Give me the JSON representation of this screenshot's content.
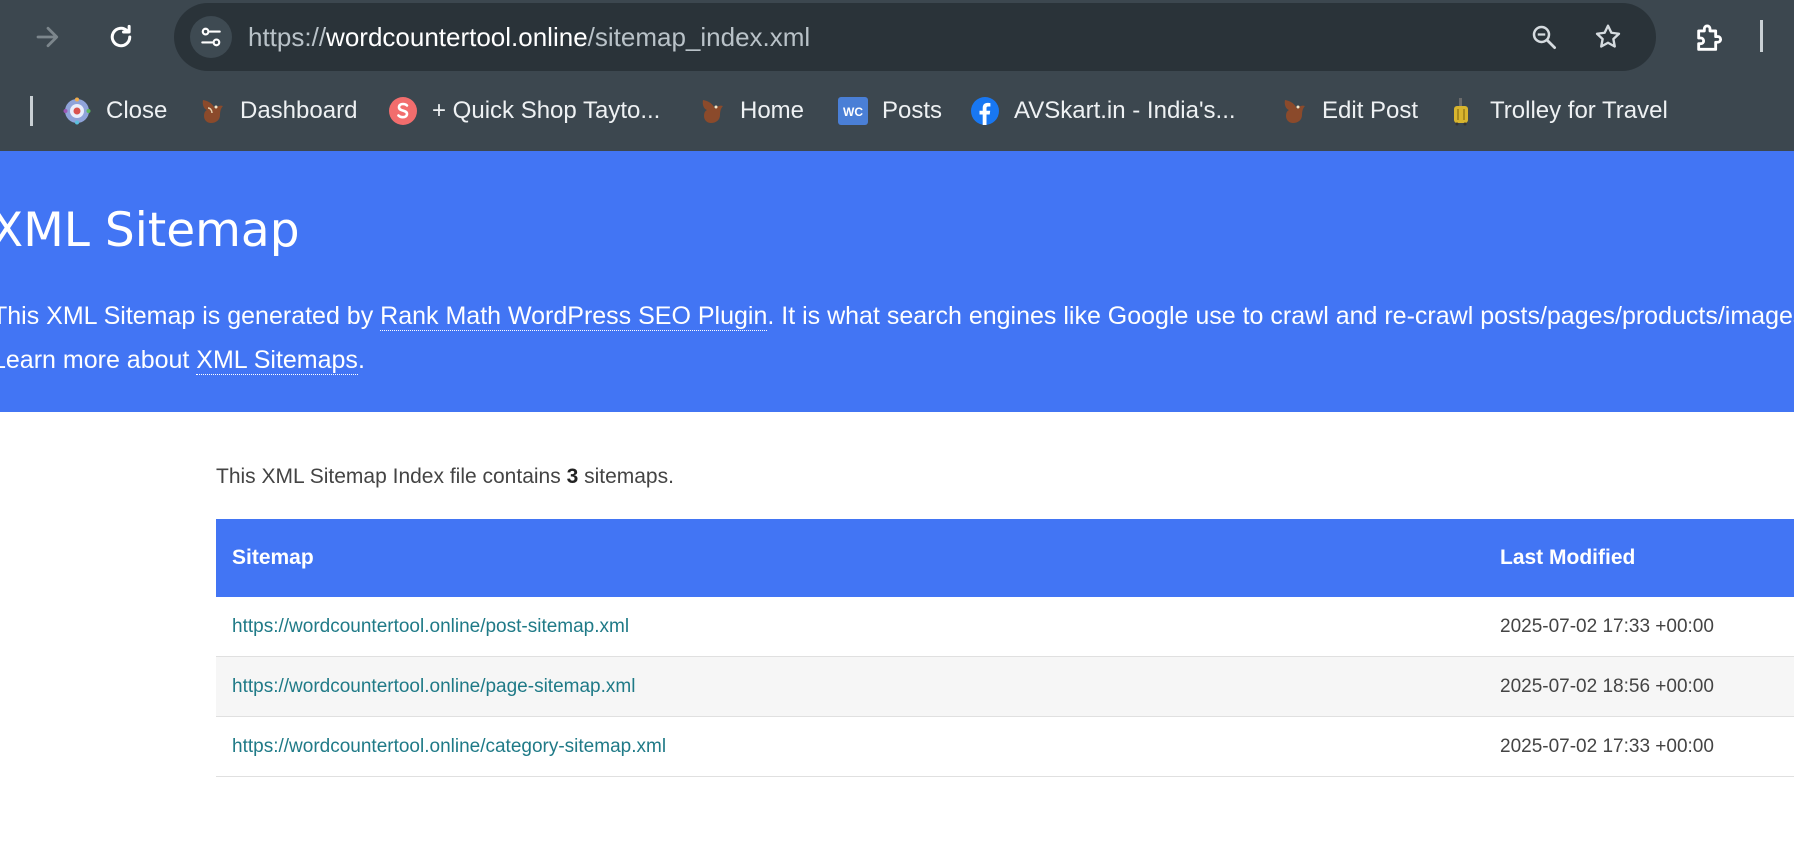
{
  "browser": {
    "url_scheme": "https://",
    "url_host": "wordcountertool.online",
    "url_path": "/sitemap_index.xml",
    "bookmarks": [
      {
        "label": "Close",
        "icon": "gear-globe-icon"
      },
      {
        "label": "Dashboard",
        "icon": "eagle-icon"
      },
      {
        "label": "+ Quick Shop Tayto...",
        "icon": "s-logo-icon"
      },
      {
        "label": "Home",
        "icon": "eagle-icon"
      },
      {
        "label": "Posts",
        "icon": "woocommerce-icon"
      },
      {
        "label": "AVSkart.in - India's...",
        "icon": "facebook-icon"
      },
      {
        "label": "Edit Post",
        "icon": "eagle-icon"
      },
      {
        "label": "Trolley for Travel",
        "icon": "luggage-icon"
      }
    ],
    "woo_badge": "WC",
    "colors": {
      "chrome": "#3c474f",
      "omnibox": "#2a3339"
    }
  },
  "header": {
    "title": "XML Sitemap",
    "desc_before": "This XML Sitemap is generated by ",
    "desc_link": "Rank Math WordPress SEO Plugin",
    "desc_after": ". It is what search engines like Google use to crawl and re-crawl posts/pages/products/images/a",
    "learn_before": "Learn more about ",
    "learn_link": "XML Sitemaps",
    "learn_after": ".",
    "accent": "#4275f4"
  },
  "content": {
    "intro_before": "This XML Sitemap Index file contains ",
    "count": "3",
    "intro_after": " sitemaps.",
    "table": {
      "headers": [
        "Sitemap",
        "Last Modified"
      ],
      "rows": [
        {
          "url": "https://wordcountertool.online/post-sitemap.xml",
          "modified": "2025-07-02 17:33 +00:00"
        },
        {
          "url": "https://wordcountertool.online/page-sitemap.xml",
          "modified": "2025-07-02 18:56 +00:00"
        },
        {
          "url": "https://wordcountertool.online/category-sitemap.xml",
          "modified": "2025-07-02 17:33 +00:00"
        }
      ]
    }
  }
}
